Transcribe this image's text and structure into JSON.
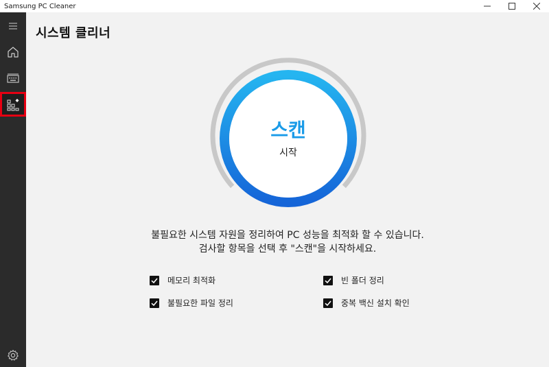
{
  "window": {
    "title": "Samsung PC Cleaner",
    "controls": [
      "minimize",
      "maximize",
      "close"
    ]
  },
  "sidebar": {
    "items": [
      {
        "icon": "menu-icon",
        "active": false
      },
      {
        "icon": "home-icon",
        "active": false
      },
      {
        "icon": "keyboard-icon",
        "active": false
      },
      {
        "icon": "system-cleaner-icon",
        "active": true
      },
      {
        "icon": "settings-icon",
        "active": false
      }
    ]
  },
  "main": {
    "title": "시스템 클리너",
    "scan": {
      "label": "스캔",
      "sub_label": "시작"
    },
    "description": {
      "line1": "불필요한 시스템 자원을 정리하여 PC 성능을 최적화 할 수 있습니다.",
      "line2": "검사할 항목을 선택 후 \"스캔\"을 시작하세요."
    },
    "options": [
      {
        "label": "메모리 최적화",
        "checked": true
      },
      {
        "label": "빈 폴더 정리",
        "checked": true
      },
      {
        "label": "불필요한 파일 정리",
        "checked": true
      },
      {
        "label": "중복 백신 설치 확인",
        "checked": true
      }
    ]
  },
  "colors": {
    "accent": "#1a9be8",
    "ring_gradient_start": "#25b5f0",
    "ring_gradient_end": "#1565d8",
    "outer_arc": "#c8c8c8",
    "sidebar": "#2b2b2b",
    "highlight": "#e60012"
  }
}
